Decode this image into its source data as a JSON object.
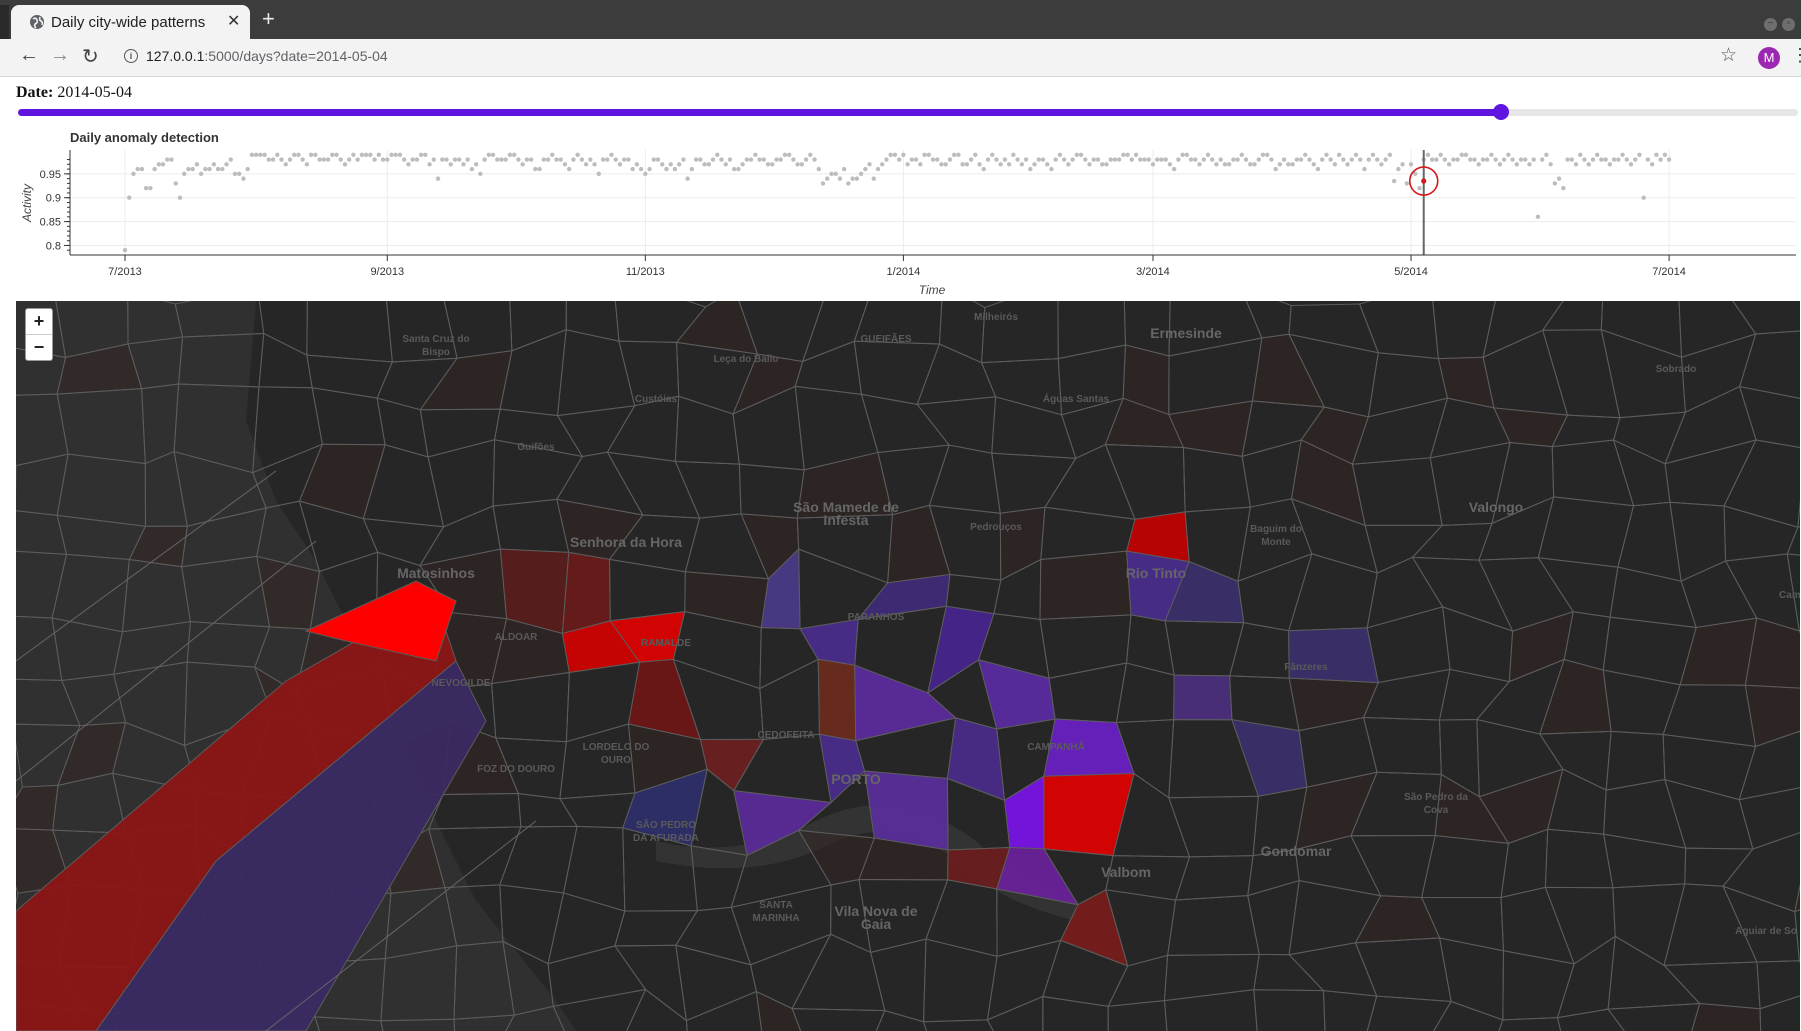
{
  "browser": {
    "tab_title": "Daily city-wide patterns",
    "tab_close": "✕",
    "new_tab": "+",
    "url_host": "127.0.0.1",
    "url_rest": ":5000/days?date=2014-05-04",
    "profile_initial": "M"
  },
  "page": {
    "date_label": "Date:",
    "date_value": "2014-05-04",
    "slider_position": 0.833
  },
  "chart_data": {
    "type": "scatter",
    "title": "Daily anomaly detection",
    "xlabel": "Time",
    "ylabel": "Activity",
    "x_ticks": [
      "7/2013",
      "9/2013",
      "11/2013",
      "1/2014",
      "3/2014",
      "5/2014",
      "7/2014"
    ],
    "y_ticks": [
      "0.8",
      "0.85",
      "0.9",
      "0.95"
    ],
    "xlim": [
      "2013-06-18",
      "2014-07-31"
    ],
    "ylim": [
      0.78,
      1.0
    ],
    "grid": true,
    "selected_date": "2014-05-04",
    "selected_value": 0.935,
    "selected_color": "#d7191c",
    "point_color": "#bdbdbd",
    "series": [
      {
        "x_start": "2013-07-01",
        "values": [
          0.79,
          0.9,
          0.95,
          0.96,
          0.96,
          0.92,
          0.92,
          0.96,
          0.97,
          0.97,
          0.98,
          0.98,
          0.93,
          0.9,
          0.95,
          0.96,
          0.96,
          0.97,
          0.95,
          0.96,
          0.96,
          0.97,
          0.96,
          0.96,
          0.97,
          0.98,
          0.95,
          0.95,
          0.94,
          0.96,
          0.99,
          0.99,
          0.99,
          0.99,
          0.98,
          0.98,
          0.99,
          0.98,
          0.97,
          0.98,
          0.99,
          0.99,
          0.98,
          0.97,
          0.99,
          0.99,
          0.98,
          0.98,
          0.98,
          0.99,
          0.99,
          0.98,
          0.97,
          0.98,
          0.99,
          0.98,
          0.99,
          0.99,
          0.99,
          0.98,
          0.99,
          0.98,
          0.98,
          0.99,
          0.99,
          0.99,
          0.98,
          0.97,
          0.98,
          0.98,
          0.99,
          0.99,
          0.97,
          0.98,
          0.94,
          0.98,
          0.98,
          0.97,
          0.98,
          0.98,
          0.97,
          0.98,
          0.96,
          0.97,
          0.95,
          0.98,
          0.99,
          0.99,
          0.98,
          0.98,
          0.98,
          0.99,
          0.99,
          0.98,
          0.97,
          0.98,
          0.98,
          0.96,
          0.96,
          0.98,
          0.98,
          0.99,
          0.98,
          0.98,
          0.97,
          0.96,
          0.98,
          0.99,
          0.98,
          0.97,
          0.98,
          0.97,
          0.95,
          0.98,
          0.98,
          0.99,
          0.98,
          0.97,
          0.98,
          0.98,
          0.96,
          0.97,
          0.96,
          0.95,
          0.96,
          0.98,
          0.98,
          0.97,
          0.96,
          0.97,
          0.96,
          0.97,
          0.98,
          0.94,
          0.96,
          0.98,
          0.98,
          0.97,
          0.97,
          0.98,
          0.99,
          0.98,
          0.97,
          0.98,
          0.96,
          0.96,
          0.97,
          0.98,
          0.98,
          0.99,
          0.98,
          0.98,
          0.97,
          0.97,
          0.98,
          0.98,
          0.99,
          0.99,
          0.98,
          0.97,
          0.97,
          0.98,
          0.99,
          0.98,
          0.96,
          0.93,
          0.94,
          0.95,
          0.95,
          0.94,
          0.96,
          0.93,
          0.94,
          0.94,
          0.95,
          0.96,
          0.97,
          0.94,
          0.96,
          0.97,
          0.98,
          0.99,
          0.99,
          0.98,
          0.99,
          0.97,
          0.98,
          0.98,
          0.97,
          0.99,
          0.99,
          0.98,
          0.98,
          0.97,
          0.97,
          0.98,
          0.99,
          0.99,
          0.97,
          0.97,
          0.98,
          0.99,
          0.97,
          0.96,
          0.98,
          0.99,
          0.98,
          0.97,
          0.98,
          0.97,
          0.99,
          0.98,
          0.97,
          0.98,
          0.96,
          0.97,
          0.98,
          0.98,
          0.97,
          0.96,
          0.98,
          0.99,
          0.98,
          0.97,
          0.98,
          0.99,
          0.99,
          0.98,
          0.97,
          0.98,
          0.98,
          0.97,
          0.97,
          0.98,
          0.98,
          0.98,
          0.99,
          0.99,
          0.98,
          0.99,
          0.98,
          0.98,
          0.98,
          0.97,
          0.98,
          0.98,
          0.98,
          0.97,
          0.96,
          0.98,
          0.99,
          0.99,
          0.98,
          0.98,
          0.97,
          0.98,
          0.99,
          0.98,
          0.97,
          0.98,
          0.97,
          0.97,
          0.98,
          0.98,
          0.99,
          0.98,
          0.97,
          0.97,
          0.98,
          0.99,
          0.99,
          0.98,
          0.96,
          0.97,
          0.98,
          0.97,
          0.97,
          0.98,
          0.98,
          0.99,
          0.98,
          0.97,
          0.96,
          0.98,
          0.99,
          0.98,
          0.97,
          0.99,
          0.98,
          0.97,
          0.98,
          0.99,
          0.98,
          0.96,
          0.98,
          0.99,
          0.98,
          0.97,
          0.98,
          0.99,
          0.935,
          0.96,
          0.97,
          0.93,
          0.97,
          0.95,
          0.92,
          0.98,
          0.99,
          0.98,
          0.98,
          0.99,
          0.98,
          0.97,
          0.98,
          0.98,
          0.99,
          0.99,
          0.98,
          0.98,
          0.97,
          0.98,
          0.98,
          0.99,
          0.98,
          0.97,
          0.98,
          0.99,
          0.98,
          0.97,
          0.98,
          0.98,
          0.97,
          0.98,
          0.86,
          0.98,
          0.99,
          0.97,
          0.93,
          0.94,
          0.92,
          0.98,
          0.98,
          0.97,
          0.99,
          0.98,
          0.97,
          0.98,
          0.99,
          0.98,
          0.98,
          0.97,
          0.98,
          0.98,
          0.99,
          0.98,
          0.97,
          0.98,
          0.99,
          0.9,
          0.98,
          0.97,
          0.99,
          0.98,
          0.99,
          0.98
        ]
      }
    ]
  },
  "map": {
    "zoom_in": "+",
    "zoom_out": "−",
    "places": [
      {
        "name": "Santa Cruz do Bispo",
        "lines": [
          "Santa Cruz do",
          "Bispo"
        ],
        "size": "sm"
      },
      {
        "name": "Leça do Balio",
        "lines": [
          "Leça do Balio"
        ],
        "size": "sm"
      },
      {
        "name": "GUEIFÃES",
        "lines": [
          "GUEIFÃES"
        ],
        "size": "sm"
      },
      {
        "name": "Milheirós",
        "lines": [
          "Milheirós"
        ],
        "size": "sm"
      },
      {
        "name": "Ermesinde",
        "lines": [
          "Ermesinde"
        ],
        "size": "big"
      },
      {
        "name": "Sobrado",
        "lines": [
          "Sobrado"
        ],
        "size": "sm"
      },
      {
        "name": "Custóias",
        "lines": [
          "Custóias"
        ],
        "size": "sm"
      },
      {
        "name": "Águas Santas",
        "lines": [
          "Águas Santas"
        ],
        "size": "sm"
      },
      {
        "name": "Guifões",
        "lines": [
          "Guifões"
        ],
        "size": "sm"
      },
      {
        "name": "São Mamede de Infesta",
        "lines": [
          "São Mamede de",
          "Infesta"
        ],
        "size": "big"
      },
      {
        "name": "Pedrouços",
        "lines": [
          "Pedrouços"
        ],
        "size": "sm"
      },
      {
        "name": "Valongo",
        "lines": [
          "Valongo"
        ],
        "size": "big"
      },
      {
        "name": "Baguim do Monte",
        "lines": [
          "Baguim do",
          "Monte"
        ],
        "size": "sm"
      },
      {
        "name": "Senhora da Hora",
        "lines": [
          "Senhora da Hora"
        ],
        "size": "big"
      },
      {
        "name": "Matosinhos",
        "lines": [
          "Matosinhos"
        ],
        "size": "big"
      },
      {
        "name": "Rio Tinto",
        "lines": [
          "Rio Tinto"
        ],
        "size": "big"
      },
      {
        "name": "Campo",
        "lines": [
          "Campo"
        ],
        "size": "sm"
      },
      {
        "name": "PARANHOS",
        "lines": [
          "PARANHOS"
        ],
        "size": "sm"
      },
      {
        "name": "ALDOAR",
        "lines": [
          "ALDOAR"
        ],
        "size": "sm"
      },
      {
        "name": "RAMALDE",
        "lines": [
          "RAMALDE"
        ],
        "size": "sm"
      },
      {
        "name": "NEVOGILDE",
        "lines": [
          "NEVOGILDE"
        ],
        "size": "sm"
      },
      {
        "name": "Fânzeres",
        "lines": [
          "Fânzeres"
        ],
        "size": "sm"
      },
      {
        "name": "CEDOFEITA",
        "lines": [
          "CEDOFEITA"
        ],
        "size": "sm"
      },
      {
        "name": "LORDELO DO OURO",
        "lines": [
          "LORDELO DO",
          "OURO"
        ],
        "size": "sm"
      },
      {
        "name": "CAMPANHÃ",
        "lines": [
          "CAMPANHÃ"
        ],
        "size": "sm"
      },
      {
        "name": "FOZ DO DOURO",
        "lines": [
          "FOZ DO DOURO"
        ],
        "size": "sm"
      },
      {
        "name": "PORTO",
        "lines": [
          "PORTO"
        ],
        "size": "big"
      },
      {
        "name": "SÃO PEDRO DA AFURADA",
        "lines": [
          "SÃO PEDRO",
          "DA AFURADA"
        ],
        "size": "sm"
      },
      {
        "name": "São Pedro da Cova",
        "lines": [
          "São Pedro da",
          "Cova"
        ],
        "size": "sm"
      },
      {
        "name": "Gondomar",
        "lines": [
          "Gondomar"
        ],
        "size": "big"
      },
      {
        "name": "Valbom",
        "lines": [
          "Valbom"
        ],
        "size": "big"
      },
      {
        "name": "SANTA MARINHA",
        "lines": [
          "SANTA",
          "MARINHA"
        ],
        "size": "sm"
      },
      {
        "name": "Vila Nova de Gaia",
        "lines": [
          "Vila Nova de",
          "Gaia"
        ],
        "size": "big"
      },
      {
        "name": "Aguiar de Sousa",
        "lines": [
          "Aguiar de So"
        ],
        "size": "sm"
      }
    ]
  }
}
